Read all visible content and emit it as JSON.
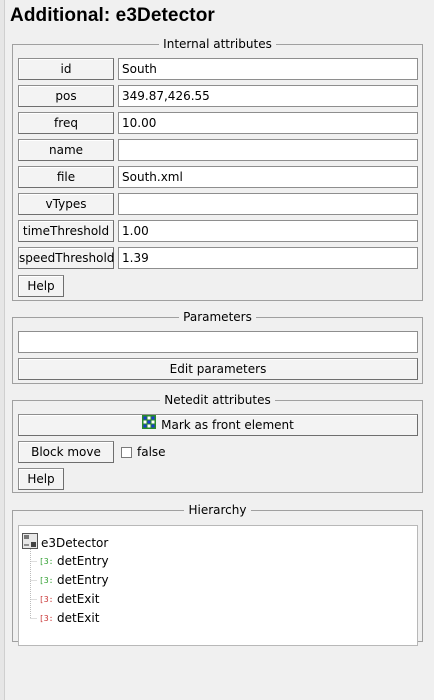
{
  "frame": {
    "title": "Additional: e3Detector"
  },
  "internal_attributes": {
    "title": "Internal attributes",
    "rows": [
      {
        "label": "id",
        "value": "South"
      },
      {
        "label": "pos",
        "value": "349.87,426.55"
      },
      {
        "label": "freq",
        "value": "10.00"
      },
      {
        "label": "name",
        "value": ""
      },
      {
        "label": "file",
        "value": "South.xml"
      },
      {
        "label": "vTypes",
        "value": ""
      },
      {
        "label": "timeThreshold",
        "value": "1.00"
      },
      {
        "label": "speedThreshold",
        "value": "1.39"
      }
    ],
    "help_label": "Help"
  },
  "parameters": {
    "title": "Parameters",
    "value": "",
    "edit_label": "Edit parameters"
  },
  "netedit_attributes": {
    "title": "Netedit attributes",
    "front_label": "Mark as front element",
    "front_icon": "front-element-icon",
    "block_move_label": "Block move",
    "block_move_value": "false",
    "help_label": "Help"
  },
  "hierarchy": {
    "title": "Hierarchy",
    "root": {
      "label": "e3Detector",
      "icon": "e3-detector-icon"
    },
    "children": [
      {
        "label": "detEntry",
        "icon_text": "[3:",
        "color": "#2e9e2e"
      },
      {
        "label": "detEntry",
        "icon_text": "[3:",
        "color": "#2e9e2e"
      },
      {
        "label": "detExit",
        "icon_text": "[3:",
        "color": "#c83232"
      },
      {
        "label": "detExit",
        "icon_text": "[3:",
        "color": "#c83232"
      }
    ]
  }
}
